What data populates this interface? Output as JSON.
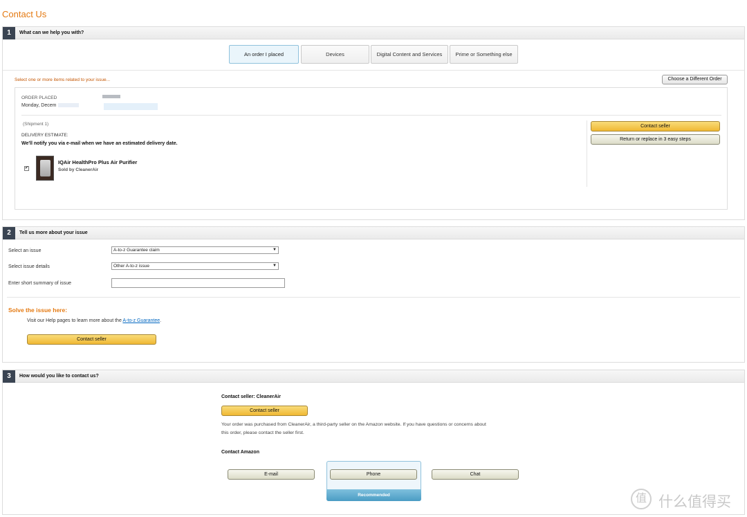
{
  "page": {
    "title": "Contact Us"
  },
  "section1": {
    "number": "1",
    "title": "What can we help you with?",
    "tabs": [
      {
        "label": "An order I placed",
        "active": true
      },
      {
        "label": "Devices",
        "active": false
      },
      {
        "label": "Digital Content and Services",
        "active": false
      },
      {
        "label": "Prime or Something else",
        "active": false
      }
    ],
    "select_prompt": "Select one or more items related to your issue...",
    "choose_order_button": "Choose a Different Order",
    "order_placed_label": "ORDER PLACED",
    "order_date": "Monday, Decem",
    "shipment": "(Shipment 1)",
    "delivery_label": "DELIVERY ESTIMATE:",
    "delivery_note": "We'll notify you via e-mail when we have an estimated delivery date.",
    "item": {
      "name": "IQAir HealthPro Plus Air Purifier",
      "seller": "Sold by CleanerAir",
      "checked": true
    },
    "contact_seller_button": "Contact seller",
    "return_button": "Return or replace in 3 easy steps"
  },
  "section2": {
    "number": "2",
    "title": "Tell us more about your issue",
    "issue_label": "Select an issue",
    "issue_value": "A-to-z Guarantee claim",
    "details_label": "Select issue details",
    "details_value": "Other A-to-z issue",
    "summary_label": "Enter short summary of issue",
    "summary_value": "",
    "solve_heading": "Solve the issue here:",
    "help_text": "Visit our Help pages to learn more about the",
    "help_link": "A-to-z Guarantee",
    "help_end": ".",
    "contact_seller_button": "Contact seller"
  },
  "section3": {
    "number": "3",
    "title": "How would you like to contact us?",
    "seller_heading": "Contact seller: CleanerAir",
    "contact_seller_button": "Contact seller",
    "seller_note_1": "Your order was purchased from CleanerAir, a third-party seller on the Amazon website. If you have questions or concerns about",
    "seller_note_2": "this order, please contact the seller first.",
    "amazon_heading": "Contact Amazon",
    "email_button": "E-mail",
    "phone_button": "Phone",
    "chat_button": "Chat",
    "recommended": "Recommended"
  },
  "watermark": {
    "text": "什么值得买"
  }
}
